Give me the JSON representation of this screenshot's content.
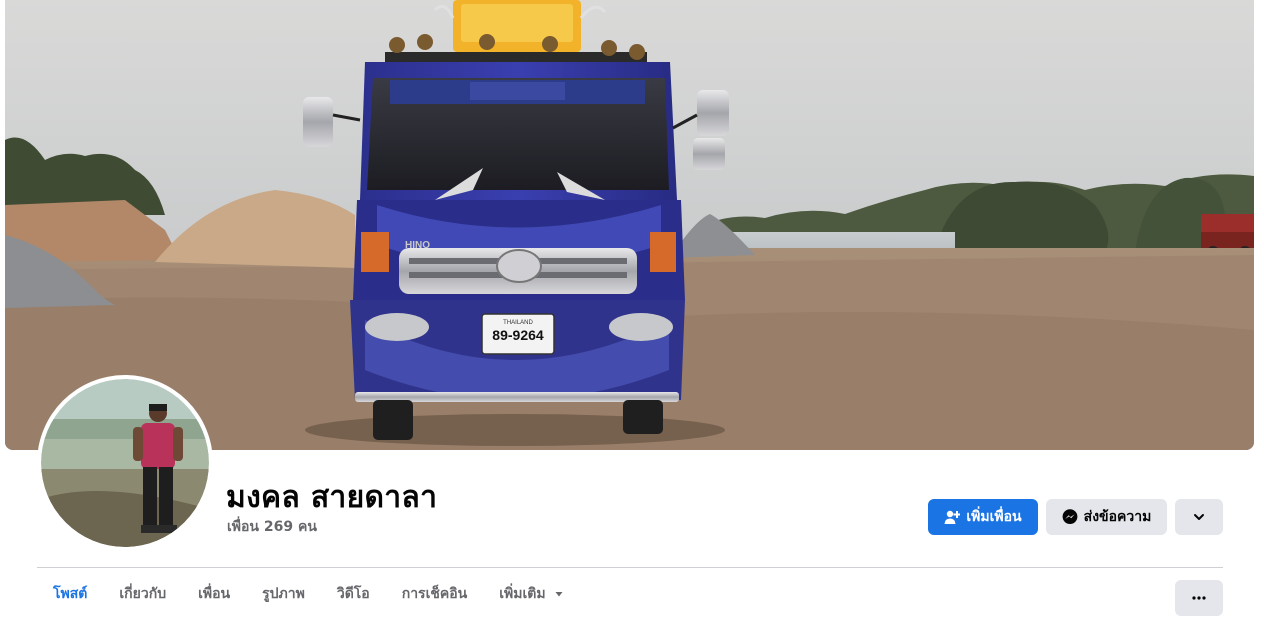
{
  "profile": {
    "name": "มงคล สายดาลา",
    "friends_text": "เพื่อน 269 คน"
  },
  "cover": {
    "plate_number": "89-9264",
    "plate_country": "THAILAND",
    "truck_brand": "HINO"
  },
  "actions": {
    "add_friend_label": "เพิ่มเพื่อน",
    "message_label": "ส่งข้อความ",
    "add_friend_icon": "person-add-icon",
    "message_icon": "messenger-icon",
    "more_icon": "chevron-down-icon"
  },
  "tabs": [
    {
      "label": "โพสต์",
      "active": true
    },
    {
      "label": "เกี่ยวกับ",
      "active": false
    },
    {
      "label": "เพื่อน",
      "active": false
    },
    {
      "label": "รูปภาพ",
      "active": false
    },
    {
      "label": "วิดีโอ",
      "active": false
    },
    {
      "label": "การเช็คอิน",
      "active": false
    },
    {
      "label": "เพิ่มเติม",
      "active": false
    }
  ],
  "tab_more_icon": "ellipsis-icon",
  "colors": {
    "primary": "#1b74e4",
    "secondary_bg": "#e4e6eb",
    "muted_text": "#65676b"
  }
}
